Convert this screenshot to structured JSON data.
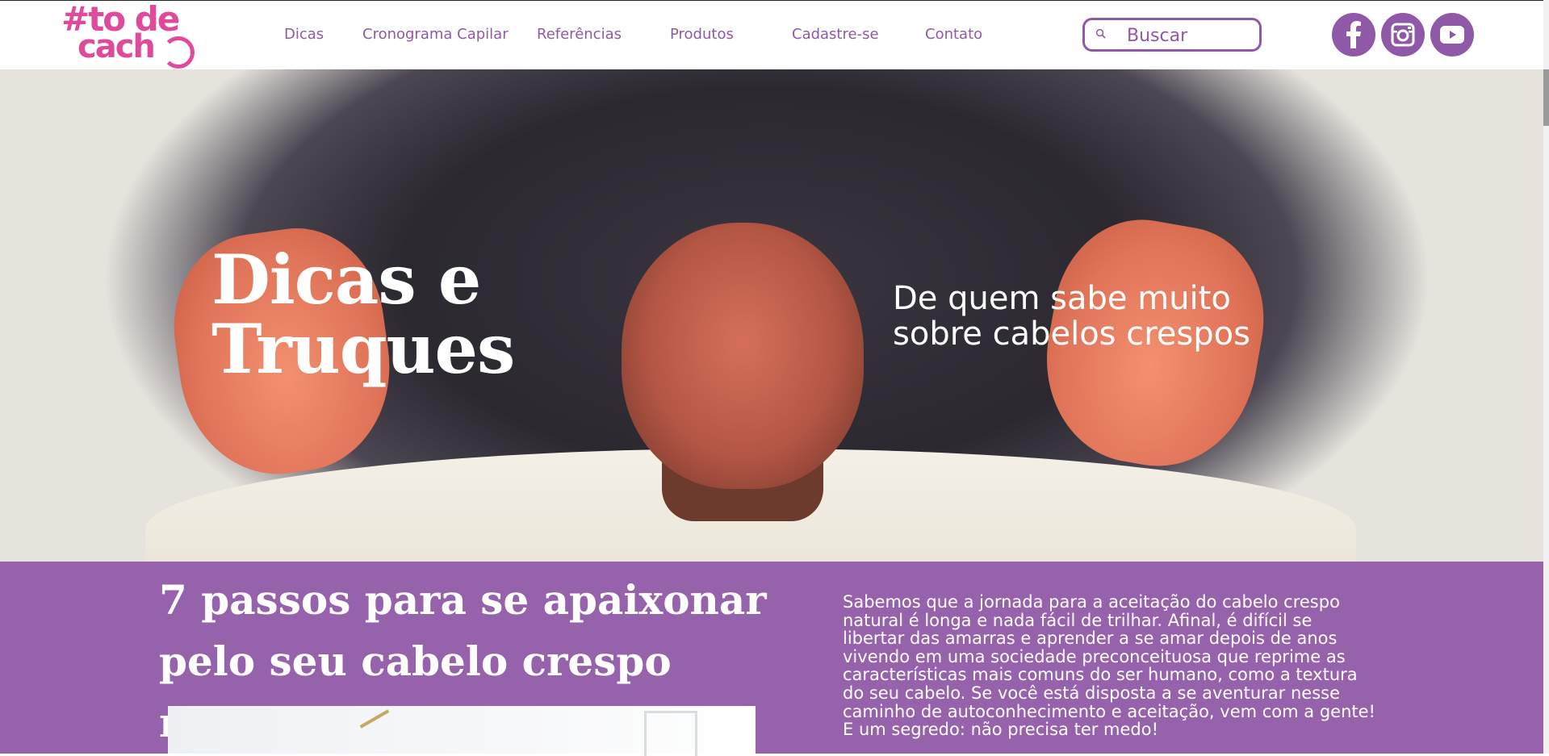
{
  "logo": {
    "line1": "#to de",
    "line2": "cach"
  },
  "nav": {
    "items": [
      {
        "label": "Dicas"
      },
      {
        "label": "Cronograma Capilar"
      },
      {
        "label": "Referências"
      },
      {
        "label": "Produtos"
      },
      {
        "label": "Cadastre-se"
      },
      {
        "label": "Contato"
      }
    ]
  },
  "search": {
    "placeholder": "Buscar",
    "value": ""
  },
  "social": [
    {
      "icon": "facebook-icon"
    },
    {
      "icon": "instagram-icon"
    },
    {
      "icon": "youtube-icon"
    }
  ],
  "hero": {
    "title_line1": "Dicas e",
    "title_line2": "Truques",
    "subtitle_line1": "De quem sabe muito",
    "subtitle_line2": "sobre cabelos crespos"
  },
  "article": {
    "title_line1": "7 passos para se apaixonar",
    "title_line2": "pelo seu cabelo crespo natural",
    "text": "Sabemos que a jornada para a aceitação do cabelo crespo natural é longa e nada fácil de trilhar. Afinal, é difícil se libertar das amarras e aprender a se amar depois de anos vivendo em uma sociedade preconceituosa que reprime as características mais comuns do ser humano, como a textura do seu cabelo. Se você está disposta a se aventurar nesse caminho de autoconhecimento e aceitação, vem com a gente! E um segredo: não precisa ter medo!"
  },
  "colors": {
    "brand_purple": "#8f59a8",
    "band_purple": "#9662ac",
    "logo_pink": "#e04a9b"
  }
}
